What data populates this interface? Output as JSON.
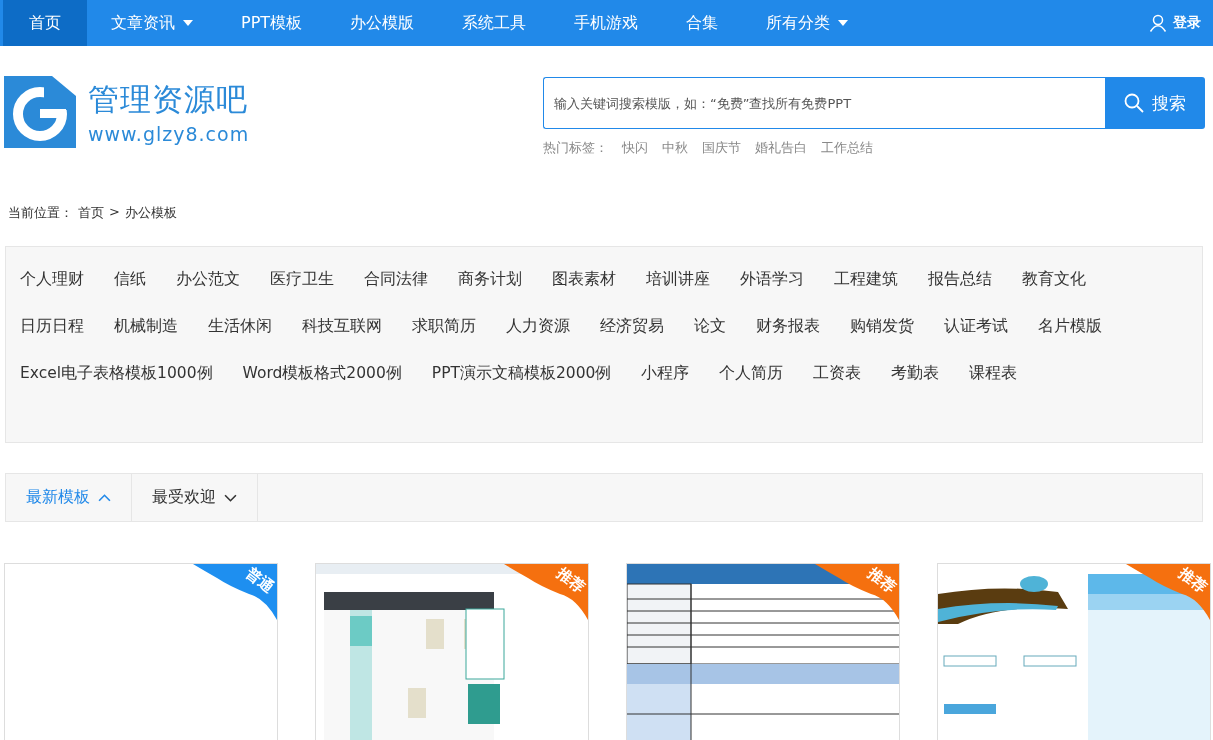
{
  "nav": {
    "items": [
      {
        "label": "首页",
        "selected": true,
        "dropdown": false
      },
      {
        "label": "文章资讯",
        "selected": false,
        "dropdown": true
      },
      {
        "label": "PPT模板",
        "selected": false,
        "dropdown": false
      },
      {
        "label": "办公模版",
        "selected": false,
        "dropdown": false
      },
      {
        "label": "系统工具",
        "selected": false,
        "dropdown": false
      },
      {
        "label": "手机游戏",
        "selected": false,
        "dropdown": false
      },
      {
        "label": "合集",
        "selected": false,
        "dropdown": false
      },
      {
        "label": "所有分类",
        "selected": false,
        "dropdown": true
      }
    ],
    "login": "登录"
  },
  "logo": {
    "name": "管理资源吧",
    "url": "www.glzy8.com"
  },
  "search": {
    "placeholder": "输入关键词搜索模版，如：“免费”查找所有免费PPT",
    "button": "搜索",
    "hot_label": "热门标签：",
    "hot_tags": [
      "快闪",
      "中秋",
      "国庆节",
      "婚礼告白",
      "工作总结"
    ]
  },
  "breadcrumb": {
    "label": "当前位置：",
    "items": [
      "首页",
      "办公模板"
    ],
    "separator": ">"
  },
  "categories": [
    [
      "个人理财",
      "信纸",
      "办公范文",
      "医疗卫生",
      "合同法律",
      "商务计划",
      "图表素材",
      "培训讲座",
      "外语学习",
      "工程建筑",
      "报告总结",
      "教育文化"
    ],
    [
      "日历日程",
      "机械制造",
      "生活休闲",
      "科技互联网",
      "求职简历",
      "人力资源",
      "经济贸易",
      "论文",
      "财务报表",
      "购销发货",
      "认证考试",
      "名片模版"
    ],
    [
      "Excel电子表格模板1000例",
      "Word模板格式2000例",
      "PPT演示文稿模板2000例",
      "小程序",
      "个人简历",
      "工资表",
      "考勤表",
      "课程表"
    ]
  ],
  "sort_tabs": [
    {
      "label": "最新模板",
      "selected": true,
      "ascending": true
    },
    {
      "label": "最受欢迎",
      "selected": false,
      "ascending": false
    }
  ],
  "cards": [
    {
      "kind": "blank",
      "badge": "普通",
      "color": "#1e8ff0"
    },
    {
      "kind": "picture",
      "badge": "推荐",
      "color": "#f5700f"
    },
    {
      "kind": "picture",
      "badge": "推荐",
      "color": "#f5700f"
    },
    {
      "kind": "picture",
      "badge": "推荐",
      "color": "#f5700f"
    }
  ]
}
